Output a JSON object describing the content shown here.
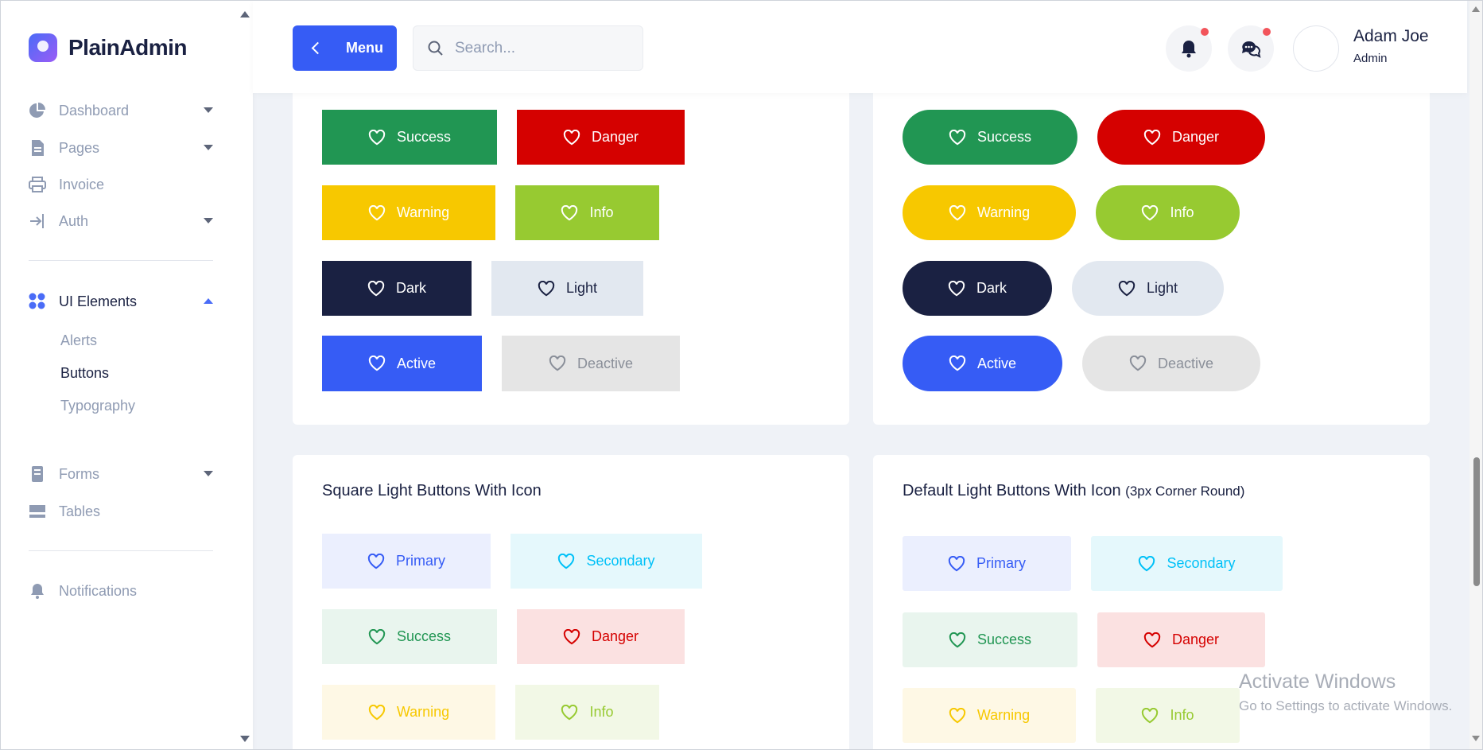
{
  "app": {
    "logo_text": "PlainAdmin",
    "accent": "#365cf5"
  },
  "sidebar": {
    "items": [
      {
        "label": "Dashboard",
        "icon": "pie-chart-icon"
      },
      {
        "label": "Pages",
        "icon": "document-icon"
      },
      {
        "label": "Invoice",
        "icon": "printer-icon"
      },
      {
        "label": "Auth",
        "icon": "login-icon"
      },
      {
        "label": "UI Elements",
        "icon": "grid-dots-icon"
      },
      {
        "label": "Forms",
        "icon": "form-icon"
      },
      {
        "label": "Tables",
        "icon": "table-icon"
      },
      {
        "label": "Notifications",
        "icon": "bell-icon"
      }
    ],
    "ui_elements_sub": [
      "Alerts",
      "Buttons",
      "Typography"
    ]
  },
  "header": {
    "menu_label": "Menu",
    "search_placeholder": "Search...",
    "user_name": "Adam Joe",
    "user_role": "Admin"
  },
  "cards": {
    "square_light_title": "Square Light Buttons With Icon",
    "default_light_title": "Default Light Buttons With Icon",
    "default_light_note": "(3px Corner Round)"
  },
  "buttons": {
    "success": "Success",
    "danger": "Danger",
    "warning": "Warning",
    "info": "Info",
    "dark": "Dark",
    "light": "Light",
    "active": "Active",
    "deactive": "Deactive",
    "primary": "Primary",
    "secondary": "Secondary"
  },
  "colors": {
    "success": "#219653",
    "danger": "#d50100",
    "warning": "#f7c800",
    "info": "#97ca31",
    "dark": "#1a2142",
    "light": "#e2e8f0",
    "active": "#365cf5",
    "deactive": "#e5e5e5"
  },
  "watermark": {
    "line1": "Activate Windows",
    "line2": "Go to Settings to activate Windows."
  }
}
